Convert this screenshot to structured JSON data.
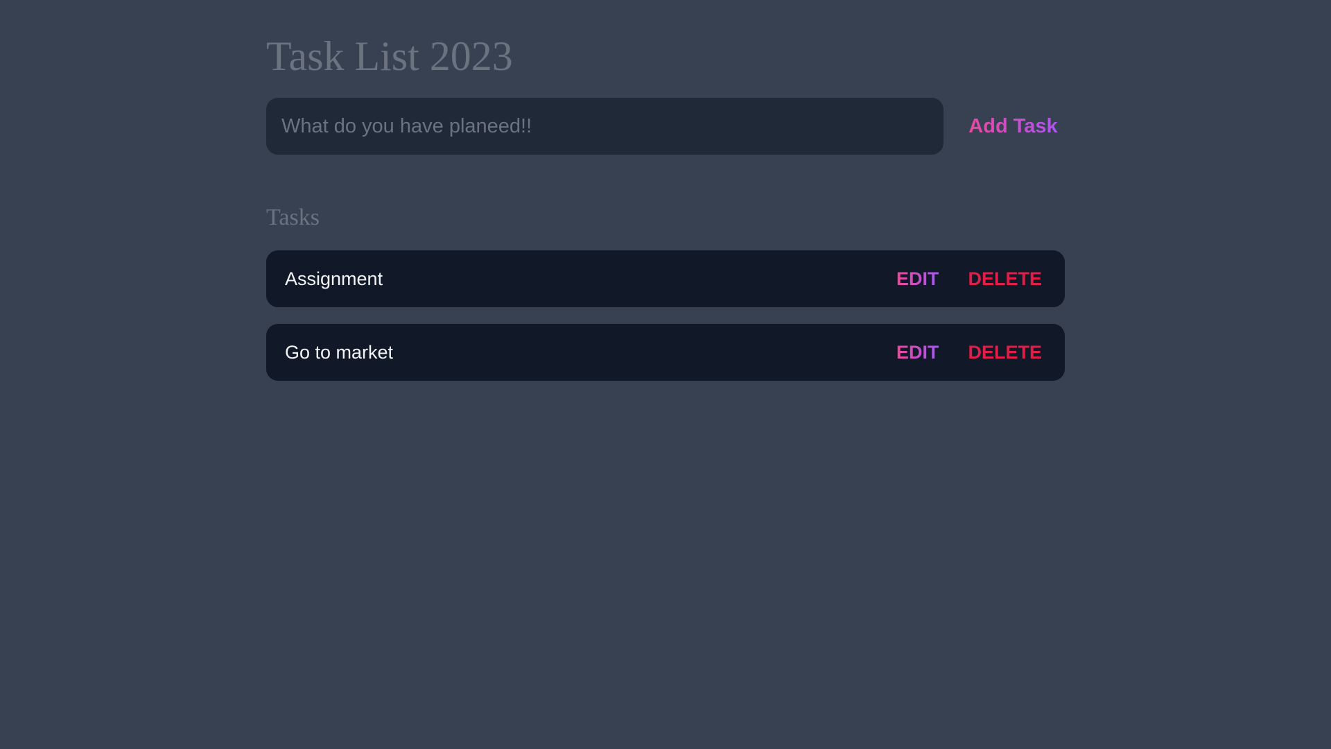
{
  "app": {
    "title": "Task List 2023"
  },
  "new_task_form": {
    "input_placeholder": "What do you have planeed!!",
    "input_value": "",
    "submit_label": "Add Task"
  },
  "tasks_section": {
    "heading": "Tasks",
    "tasks": [
      {
        "text": "Assignment",
        "edit_label": "EDIT",
        "delete_label": "DELETE"
      },
      {
        "text": "Go to market",
        "edit_label": "EDIT",
        "delete_label": "DELETE"
      }
    ]
  },
  "colors": {
    "background": "#374151",
    "input_background": "#1f2937",
    "task_background": "#111827",
    "muted_text": "#6b7280",
    "accent_gradient_start": "#ec4899",
    "accent_gradient_end": "#a855f7",
    "delete": "#e11d48"
  }
}
